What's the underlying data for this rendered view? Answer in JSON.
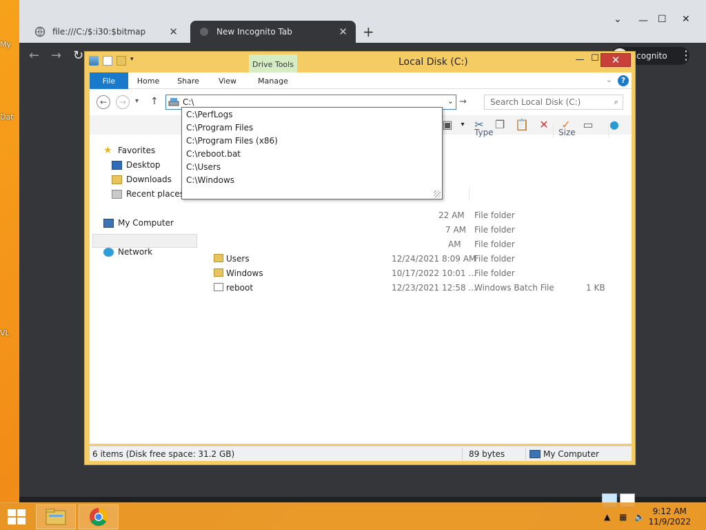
{
  "desktop": {
    "fragments": [
      "My",
      "Dat",
      "VL"
    ]
  },
  "chrome": {
    "tabs": [
      {
        "title": "file:///C:/$:i30:$bitmap"
      },
      {
        "title": "New Incognito Tab"
      }
    ],
    "new_tab_symbol": "+",
    "minimize_symbol": "—",
    "maximize_symbol": "☐",
    "close_symbol": "✕",
    "tab_close_symbol": "✕",
    "dropdown_symbol": "⌄",
    "incognito_label": "Incognito",
    "menu_symbol": "⋮",
    "nav": {
      "back": "←",
      "forward": "→",
      "reload": "↻"
    }
  },
  "explorer": {
    "title": "Local Disk (C:)",
    "drive_tools_label": "Drive Tools",
    "window_buttons": {
      "minimize": "—",
      "maximize": "☐",
      "close": "✕"
    },
    "ribbon_tabs": [
      "File",
      "Home",
      "Share",
      "View",
      "Manage"
    ],
    "help_symbol": "?",
    "address": {
      "value": "C:\\",
      "dropdown_symbol": "⌄",
      "go_symbol": "→"
    },
    "search_placeholder": "Search Local Disk (C:)",
    "search_icon_symbol": "⌕",
    "nav_buttons": {
      "back": "←",
      "forward": "→",
      "recent": "▾",
      "up": "↑"
    },
    "nav_pane": {
      "favorites": "Favorites",
      "desktop": "Desktop",
      "downloads": "Downloads",
      "recent_places": "Recent places",
      "my_computer": "My Computer",
      "network": "Network"
    },
    "columns": {
      "type": "Type",
      "size": "Size"
    },
    "rows": [
      {
        "name": "",
        "date": "22 AM",
        "type": "File folder",
        "size": ""
      },
      {
        "name": "",
        "date": "7 AM",
        "type": "File folder",
        "size": ""
      },
      {
        "name": "",
        "date": "AM",
        "type": "File folder",
        "size": ""
      },
      {
        "name": "Users",
        "date": "12/24/2021 8:09 AM",
        "type": "File folder",
        "size": ""
      },
      {
        "name": "Windows",
        "date": "10/17/2022 10:01 ...",
        "type": "File folder",
        "size": ""
      },
      {
        "name": "reboot",
        "date": "12/23/2021 12:58 ...",
        "type": "Windows Batch File",
        "size": "1 KB"
      }
    ],
    "items_count": "6 items",
    "status": {
      "left": "6 items (Disk free space: 31.2 GB)",
      "middle": "89 bytes",
      "right": "My Computer"
    }
  },
  "autocomplete": [
    "C:\\PerfLogs",
    "C:\\Program Files",
    "C:\\Program Files (x86)",
    "C:\\reboot.bat",
    "C:\\Users",
    "C:\\Windows"
  ],
  "taskbar": {
    "time": "9:12 AM",
    "date": "11/9/2022"
  },
  "colors": {
    "accent": "#1979ca",
    "titlebar": "#f5cb64",
    "close": "#c7403a",
    "drive_tools": "#d6ecc4"
  }
}
